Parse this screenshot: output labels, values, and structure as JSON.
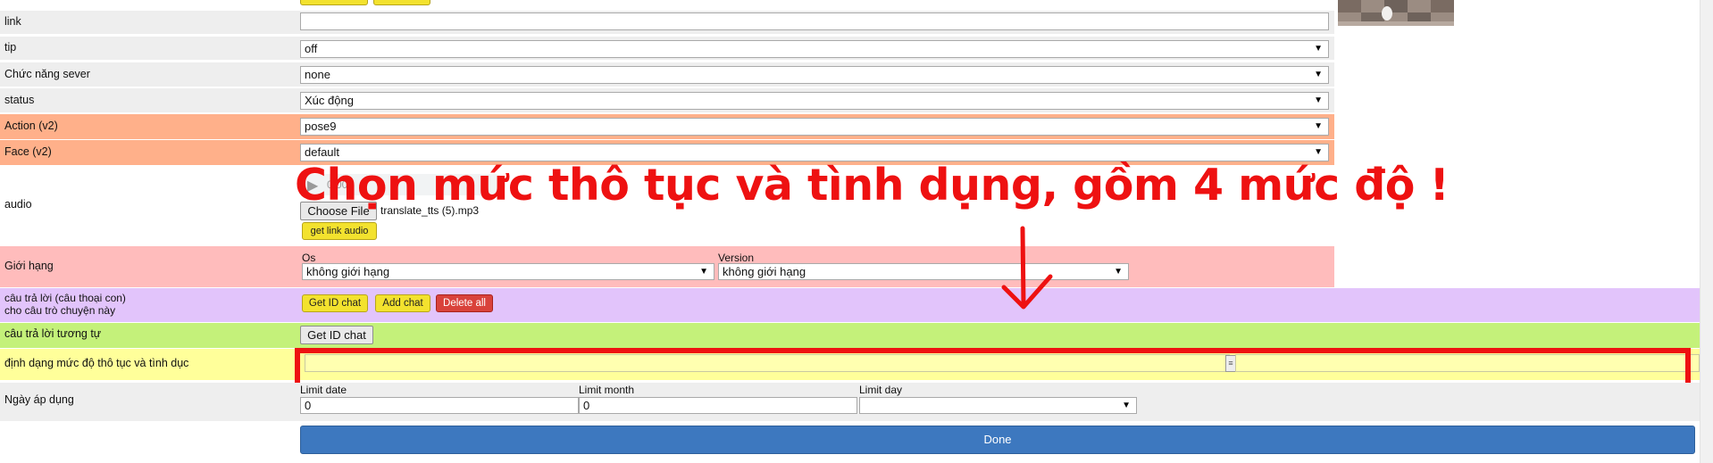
{
  "form": {
    "link": {
      "label": "link",
      "value": ""
    },
    "tip": {
      "label": "tip",
      "value": "off"
    },
    "server_function": {
      "label": "Chức năng sever",
      "value": "none"
    },
    "status": {
      "label": "status",
      "value": "Xúc động"
    },
    "action": {
      "label": "Action (v2)",
      "value": "pose9"
    },
    "face": {
      "label": "Face (v2)",
      "value": "default"
    },
    "audio": {
      "label": "audio",
      "player_time": "0:00",
      "choose_file_label": "Choose File",
      "file_name": "translate_tts (5).mp3",
      "get_link_label": "get link audio"
    },
    "limit": {
      "label": "Giới hạng",
      "os_label": "Os",
      "os_value": "không giới hạng",
      "version_label": "Version",
      "version_value": "không giới hạng"
    },
    "answers": {
      "label_line1": "câu trả lời (câu thoại con)",
      "label_line2": "cho câu trò chuyện này",
      "get_id_label": "Get ID chat",
      "add_label": "Add chat",
      "delete_label": "Delete all"
    },
    "similar": {
      "label": "câu trả lời tương tự",
      "button_label": "Get ID chat"
    },
    "vulgarity": {
      "label": "định dạng mức độ thô tục và tình dục"
    },
    "apply_date": {
      "label": "Ngày áp dụng",
      "limit_date_label": "Limit date",
      "limit_date_value": "0",
      "limit_month_label": "Limit month",
      "limit_month_value": "0",
      "limit_day_label": "Limit day",
      "limit_day_value": ""
    },
    "done_label": "Done"
  },
  "annotation": {
    "text": "Chọn mức thô tục và tình dụng, gồm 4 mức độ !",
    "color": "#ee1111"
  },
  "colors": {
    "row_gray": "#eeeeee",
    "row_orange": "#ffb08a",
    "row_pink": "#ffbcbc",
    "row_purple": "#e2c4fb",
    "row_green": "#c4f17a",
    "row_yellow": "#ffff9a",
    "done_blue": "#3d78bf"
  }
}
